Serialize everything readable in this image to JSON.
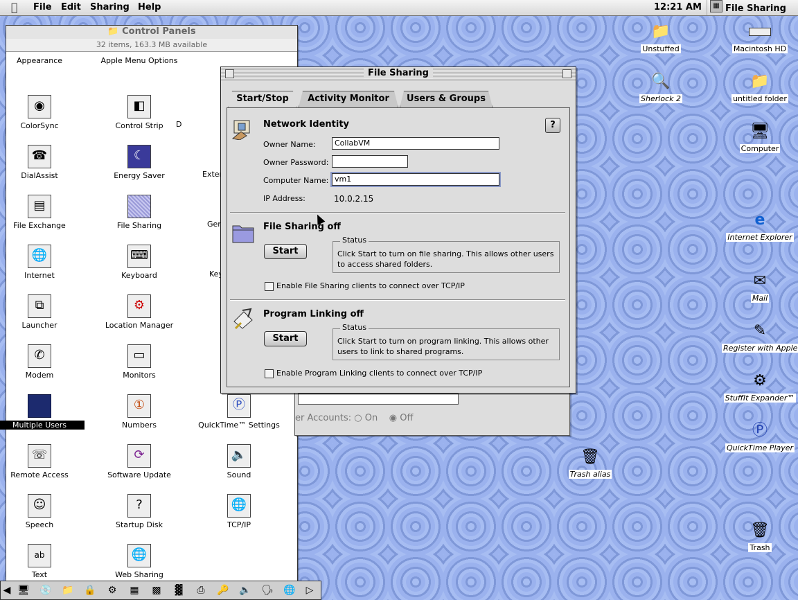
{
  "menubar": {
    "apple_icon": "apple-logo",
    "menus": [
      "File",
      "Edit",
      "Sharing",
      "Help"
    ],
    "clock": "12:21 AM",
    "app_name": "File Sharing"
  },
  "control_panels": {
    "title": "Control Panels",
    "info": "32 items, 163.3 MB available",
    "items": [
      "Appearance",
      "Apple Menu Options",
      "ColorSync",
      "Control Strip",
      "D",
      "DialAssist",
      "Energy Saver",
      "Exter",
      "File Exchange",
      "File Sharing",
      "Gen",
      "Internet",
      "Keyboard",
      "Key",
      "Launcher",
      "Location Manager",
      "Modem",
      "Monitors",
      "Multiple Users",
      "Numbers",
      "QuickTime™ Settings",
      "Remote Access",
      "Software Update",
      "Sound",
      "Speech",
      "Startup Disk",
      "TCP/IP",
      "Text",
      "Web Sharing"
    ],
    "selected": "Multiple Users"
  },
  "multiple_users_behind": {
    "accounts_label": "er Accounts:",
    "on": "On",
    "off": "Off"
  },
  "file_sharing": {
    "title": "File Sharing",
    "tabs": [
      "Start/Stop",
      "Activity Monitor",
      "Users & Groups"
    ],
    "active_tab": "Start/Stop",
    "network_identity": {
      "heading": "Network Identity",
      "owner_name_label": "Owner Name:",
      "owner_name_value": "CollabVM",
      "owner_password_label": "Owner Password:",
      "owner_password_value": "",
      "computer_name_label": "Computer Name:",
      "computer_name_value": "vm1",
      "ip_label": "IP Address:",
      "ip_value": "10.0.2.15",
      "help_label": "?"
    },
    "file_sharing_section": {
      "heading": "File Sharing off",
      "button": "Start",
      "status_label": "Status",
      "status_text": "Click Start to turn on file sharing. This allows other users to access shared folders.",
      "checkbox_label": "Enable File Sharing clients to connect over TCP/IP",
      "checkbox_checked": false
    },
    "program_linking_section": {
      "heading": "Program Linking off",
      "button": "Start",
      "status_label": "Status",
      "status_text": "Click Start to turn on program linking. This allows other users to link to shared programs.",
      "checkbox_label": "Enable Program Linking clients to connect over TCP/IP",
      "checkbox_checked": false
    }
  },
  "desktop": {
    "icons": [
      {
        "label": "Unstuffed",
        "icon": "folder-icon"
      },
      {
        "label": "Macintosh HD",
        "icon": "hard-disk-icon"
      },
      {
        "label": "Sherlock 2",
        "icon": "magnifier-icon"
      },
      {
        "label": "untitled folder",
        "icon": "folder-icon"
      },
      {
        "label": "Computer",
        "icon": "computer-icon"
      },
      {
        "label": "Internet Explorer",
        "icon": "ie-icon"
      },
      {
        "label": "Mail",
        "icon": "mail-icon"
      },
      {
        "label": "Register with Apple",
        "icon": "register-icon"
      },
      {
        "label": "StuffIt Expander™",
        "icon": "stuffit-icon"
      },
      {
        "label": "QuickTime Player",
        "icon": "quicktime-icon"
      },
      {
        "label": "Trash alias",
        "icon": "trash-icon"
      },
      {
        "label": "Trash",
        "icon": "trash-icon"
      }
    ]
  },
  "colors": {
    "desktop": "#8fa8e6",
    "window": "#dddddd",
    "selection": "#000000"
  }
}
